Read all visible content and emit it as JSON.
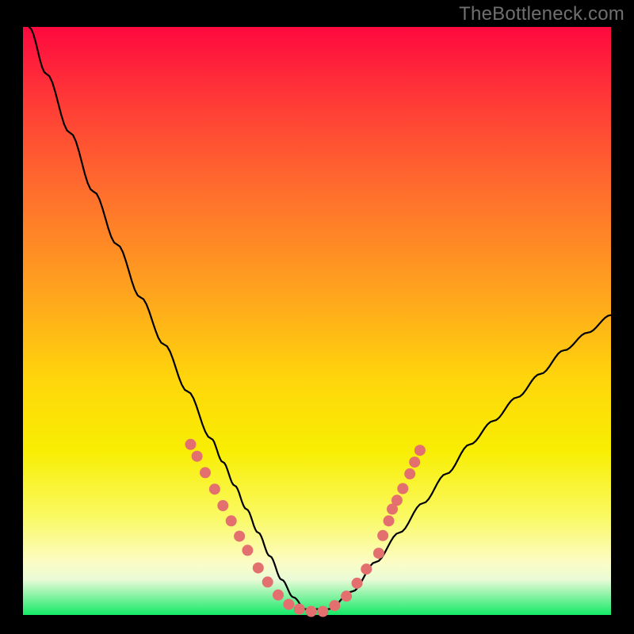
{
  "watermark": "TheBottleneck.com",
  "chart_data": {
    "type": "line",
    "title": "",
    "xlabel": "",
    "ylabel": "",
    "xlim": [
      0,
      100
    ],
    "ylim": [
      0,
      100
    ],
    "series": [
      {
        "name": "bottleneck-curve",
        "x": [
          1,
          4,
          8,
          12,
          16,
          20,
          24,
          28,
          32,
          34,
          36,
          38,
          40,
          42,
          44,
          46,
          48,
          52,
          56,
          60,
          64,
          68,
          72,
          76,
          80,
          84,
          88,
          92,
          96,
          100
        ],
        "y": [
          100,
          92,
          82,
          72,
          63,
          54,
          46,
          38,
          30,
          26,
          22,
          18,
          14,
          10,
          6,
          3,
          1,
          1,
          4,
          9,
          14,
          19,
          24,
          29,
          33,
          37,
          41,
          45,
          48,
          51
        ]
      }
    ],
    "markers": [
      {
        "x": 28.5,
        "y": 29.0
      },
      {
        "x": 29.6,
        "y": 27.0
      },
      {
        "x": 31.0,
        "y": 24.2
      },
      {
        "x": 32.6,
        "y": 21.4
      },
      {
        "x": 34.0,
        "y": 18.6
      },
      {
        "x": 35.4,
        "y": 16.0
      },
      {
        "x": 36.8,
        "y": 13.4
      },
      {
        "x": 38.2,
        "y": 11.0
      },
      {
        "x": 40.0,
        "y": 8.0
      },
      {
        "x": 41.6,
        "y": 5.6
      },
      {
        "x": 43.4,
        "y": 3.4
      },
      {
        "x": 45.2,
        "y": 1.8
      },
      {
        "x": 47.0,
        "y": 1.0
      },
      {
        "x": 49.0,
        "y": 0.6
      },
      {
        "x": 51.0,
        "y": 0.6
      },
      {
        "x": 53.0,
        "y": 1.6
      },
      {
        "x": 55.0,
        "y": 3.2
      },
      {
        "x": 56.8,
        "y": 5.4
      },
      {
        "x": 58.4,
        "y": 7.8
      },
      {
        "x": 60.5,
        "y": 10.5
      },
      {
        "x": 61.2,
        "y": 13.5
      },
      {
        "x": 62.2,
        "y": 16.0
      },
      {
        "x": 62.8,
        "y": 18.0
      },
      {
        "x": 63.6,
        "y": 19.5
      },
      {
        "x": 64.6,
        "y": 21.5
      },
      {
        "x": 65.8,
        "y": 24.0
      },
      {
        "x": 66.6,
        "y": 26.0
      },
      {
        "x": 67.5,
        "y": 28.0
      }
    ],
    "marker_color": "#e46f6f",
    "curve_color": "#000000"
  }
}
